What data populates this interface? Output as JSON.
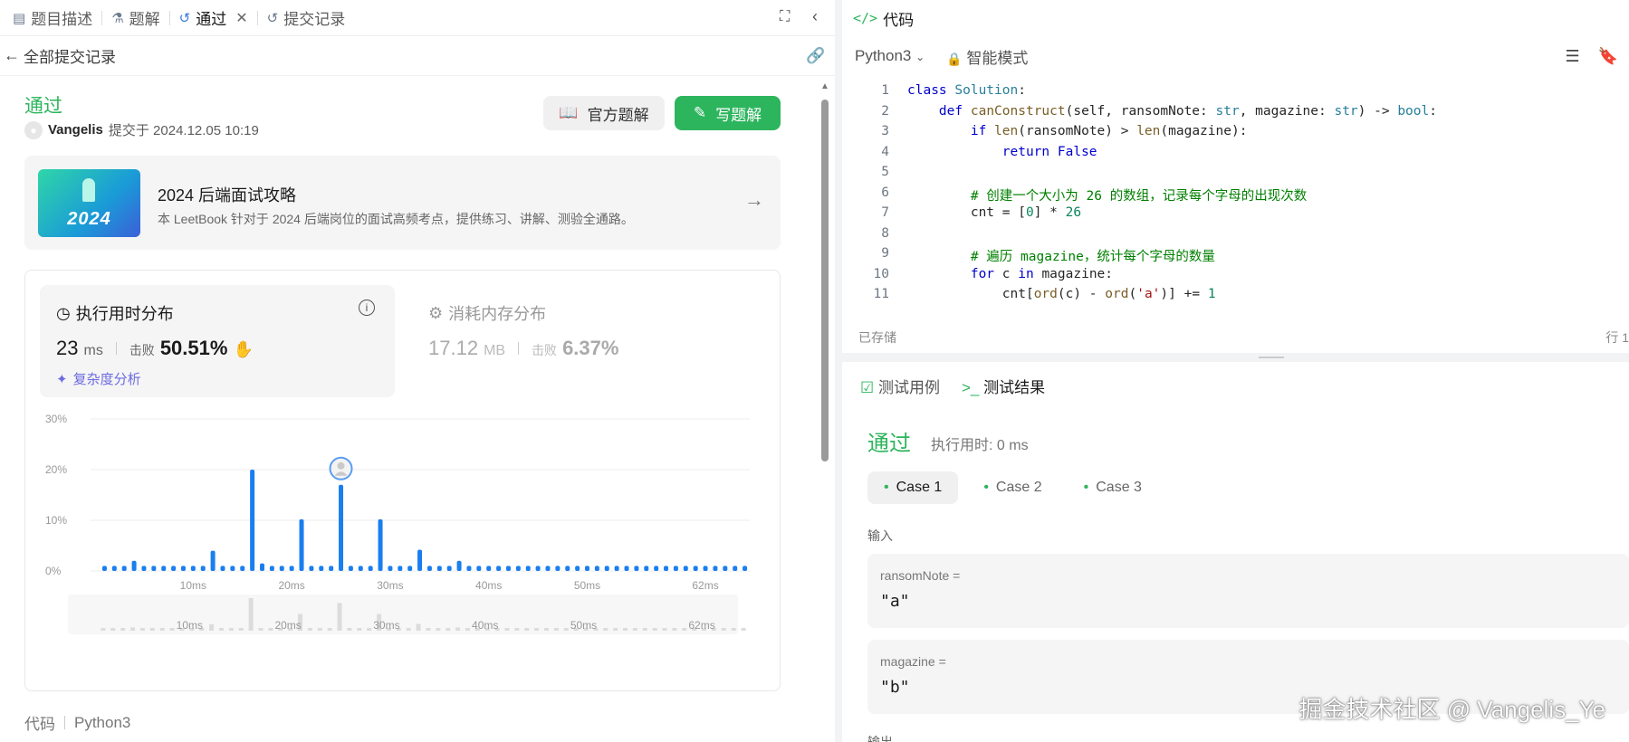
{
  "left": {
    "tabs": [
      {
        "label": "题目描述",
        "icon": "document-icon"
      },
      {
        "label": "题解",
        "icon": "flask-icon"
      },
      {
        "label": "通过",
        "icon": "history-icon"
      },
      {
        "label": "提交记录",
        "icon": "history-icon"
      }
    ],
    "back_label": "全部提交记录",
    "status": "通过",
    "user": "Vangelis",
    "submitted_text": "提交于 2024.12.05 10:19",
    "btn_official": "官方题解",
    "btn_write": "写题解",
    "promo": {
      "badge": "2024",
      "title": "2024 后端面试攻略",
      "desc": "本 LeetBook 针对于 2024 后端岗位的面试高频考点，提供练习、讲解、测验全通路。"
    },
    "runtime": {
      "title": "执行用时分布",
      "value": "23",
      "unit": "ms",
      "beats_label": "击败",
      "beats": "50.51%",
      "complexity": "复杂度分析"
    },
    "memory": {
      "title": "消耗内存分布",
      "value": "17.12",
      "unit": "MB",
      "beats_label": "击败",
      "beats": "6.37%"
    },
    "footer": {
      "label": "代码",
      "lang": "Python3"
    }
  },
  "chart_data": {
    "type": "bar",
    "yticks": [
      "30%",
      "20%",
      "10%",
      "0%"
    ],
    "ylim": [
      0,
      30
    ],
    "xticks": [
      "10ms",
      "20ms",
      "30ms",
      "40ms",
      "50ms",
      "62ms"
    ],
    "xtick_positions": [
      10,
      20,
      30,
      40,
      50,
      62
    ],
    "x": [
      1,
      2,
      3,
      4,
      5,
      6,
      7,
      8,
      9,
      10,
      11,
      12,
      13,
      14,
      15,
      16,
      17,
      18,
      19,
      20,
      21,
      22,
      23,
      24,
      25,
      26,
      27,
      28,
      29,
      30,
      31,
      32,
      33,
      34,
      35,
      36,
      37,
      38,
      39,
      40,
      41,
      42,
      43,
      44,
      45,
      46,
      47,
      48,
      49,
      50,
      51,
      52,
      53,
      54,
      55,
      56,
      57,
      58,
      59,
      60,
      61,
      62,
      63,
      64,
      65,
      66
    ],
    "values": [
      1,
      1,
      1,
      2,
      1,
      1,
      1,
      1,
      1,
      1,
      1,
      4,
      1,
      1,
      1,
      20,
      1.5,
      1,
      1,
      1,
      10.2,
      1,
      1,
      1,
      17,
      1,
      1,
      1,
      10.2,
      1,
      1,
      1,
      4.2,
      1,
      1,
      1,
      2,
      1,
      1,
      1,
      1,
      1,
      1,
      1,
      1,
      1,
      1,
      1,
      1,
      1,
      1,
      1,
      1,
      1,
      1,
      1,
      1,
      1,
      1,
      1,
      1,
      1,
      1,
      1,
      1,
      1
    ],
    "highlight_x": 25,
    "grid": true
  },
  "right": {
    "title": "代码",
    "lang": "Python3",
    "mode": "智能模式",
    "code": [
      {
        "n": "1",
        "html": "<span class='kw'>class</span> <span class='bt'>Solution</span>:"
      },
      {
        "n": "2",
        "html": "    <span class='kw'>def</span> <span class='fn'>canConstruct</span>(self, ransomNote: <span class='bt'>str</span>, magazine: <span class='bt'>str</span>) -> <span class='bt'>bool</span>:"
      },
      {
        "n": "3",
        "html": "        <span class='kw'>if</span> <span class='fn'>len</span>(ransomNote) > <span class='fn'>len</span>(magazine):"
      },
      {
        "n": "4",
        "html": "            <span class='kw'>return</span> <span class='kw'>False</span>"
      },
      {
        "n": "5",
        "html": ""
      },
      {
        "n": "6",
        "html": "        <span class='cmt'># 创建一个大小为 26 的数组，记录每个字母的出现次数</span>"
      },
      {
        "n": "7",
        "html": "        cnt = [<span class='num'>0</span>] * <span class='num'>26</span>"
      },
      {
        "n": "8",
        "html": ""
      },
      {
        "n": "9",
        "html": "        <span class='cmt'># 遍历 magazine，统计每个字母的数量</span>"
      },
      {
        "n": "10",
        "html": "        <span class='kw'>for</span> c <span class='kw'>in</span> magazine:"
      },
      {
        "n": "11",
        "html": "            cnt[<span class='fn'>ord</span>(c) - <span class='fn'>ord</span>(<span class='str'>'a'</span>)] += <span class='num'>1</span>"
      }
    ],
    "saved": "已存储",
    "row_info": "行 1",
    "tab_testcase": "测试用例",
    "tab_result": "测试结果",
    "result_status": "通过",
    "exec_time": "执行用时: 0 ms",
    "cases": [
      "Case 1",
      "Case 2",
      "Case 3"
    ],
    "input_label": "输入",
    "fields": [
      {
        "label": "ransomNote =",
        "value": "\"a\""
      },
      {
        "label": "magazine =",
        "value": "\"b\""
      }
    ],
    "output_label": "输出"
  },
  "watermark": "掘金技术社区 @ Vangelis_Ye"
}
